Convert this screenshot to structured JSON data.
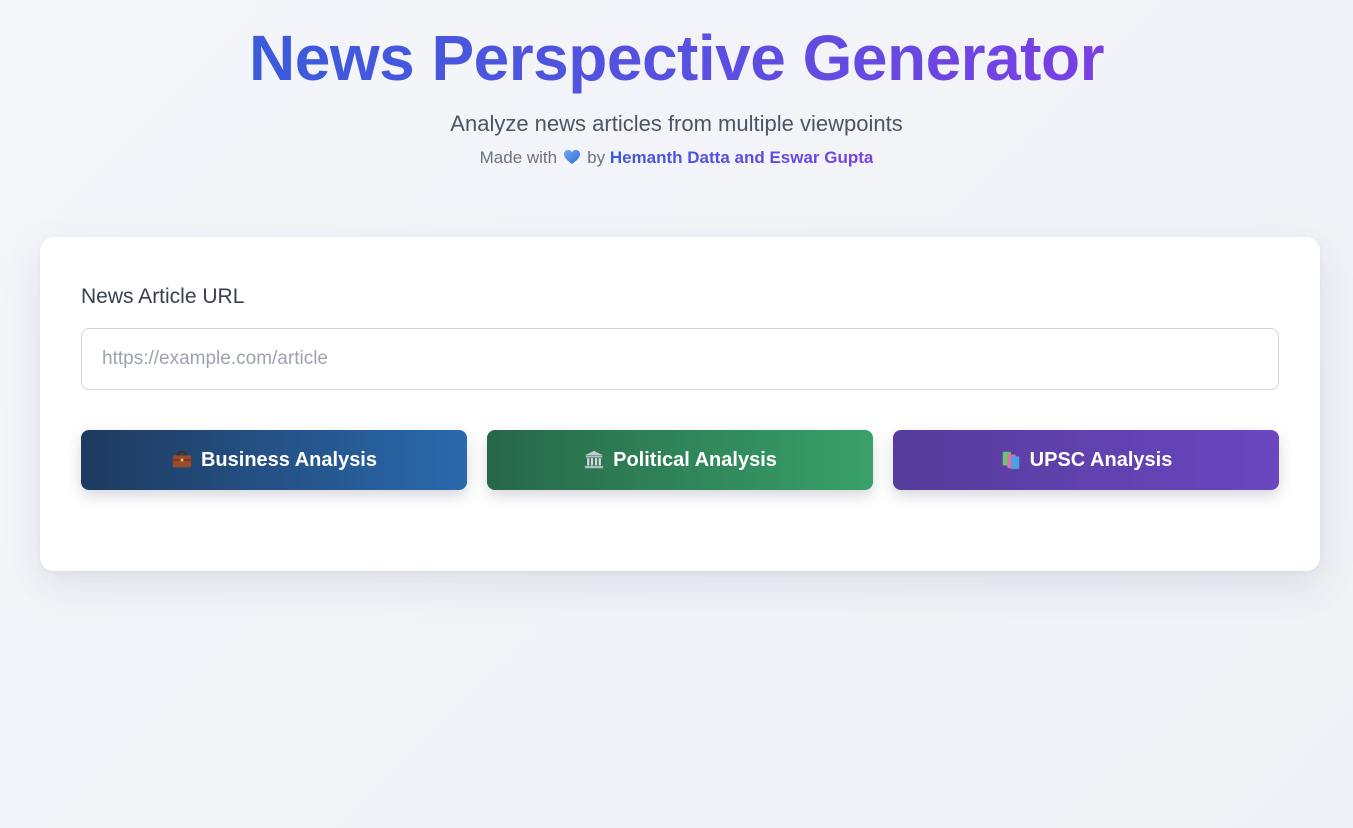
{
  "header": {
    "title": "News Perspective Generator",
    "subtitle": "Analyze news articles from multiple viewpoints",
    "credit_prefix": "Made with",
    "credit_by": "by",
    "authors": "Hemanth Datta and Eswar Gupta",
    "heart_icon": "blue-heart-icon"
  },
  "form": {
    "url_label": "News Article URL",
    "url_placeholder": "https://example.com/article",
    "url_value": ""
  },
  "actions": [
    {
      "label": "Business Analysis",
      "icon": "briefcase-icon",
      "color": "#2a69ad"
    },
    {
      "label": "Political Analysis",
      "icon": "classical-building-icon",
      "color": "#38a169"
    },
    {
      "label": "UPSC Analysis",
      "icon": "books-icon",
      "color": "#6b46c1"
    }
  ],
  "colors": {
    "title_gradient_start": "#3b5bdb",
    "title_gradient_end": "#7a3fe4",
    "background": "#f3f4f8",
    "card": "#ffffff"
  }
}
